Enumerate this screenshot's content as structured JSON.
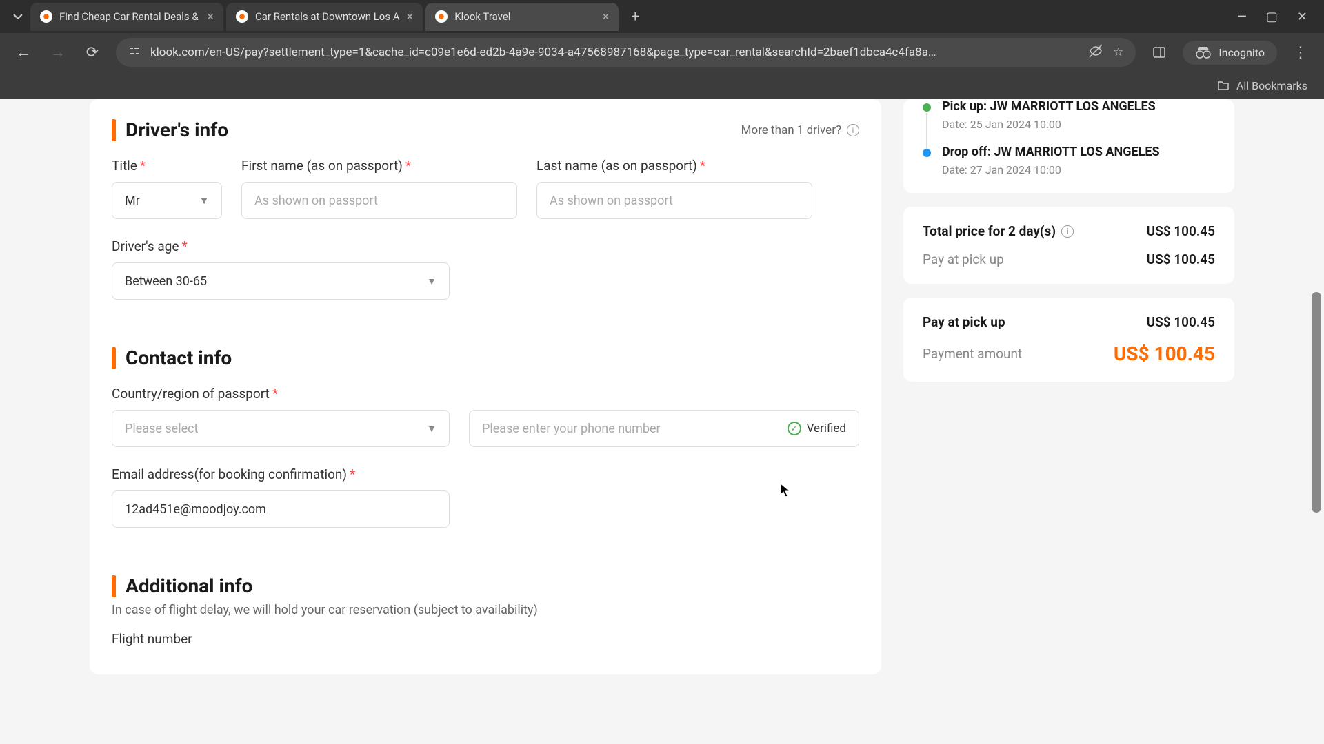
{
  "browser": {
    "tabs": [
      {
        "title": "Find Cheap Car Rental Deals &"
      },
      {
        "title": "Car Rentals at Downtown Los A"
      },
      {
        "title": "Klook Travel"
      }
    ],
    "url": "klook.com/en-US/pay?settlement_type=1&cache_id=c09e1e6d-ed2b-4a9e-9034-a47568987168&page_type=car_rental&searchId=2baef1dbca4c4fa8a…",
    "incognito_label": "Incognito",
    "bookmarks_label": "All Bookmarks"
  },
  "driver_section": {
    "title": "Driver's info",
    "more_drivers": "More than 1 driver?",
    "title_label": "Title",
    "title_value": "Mr",
    "first_name_label": "First name (as on passport)",
    "first_name_placeholder": "As shown on passport",
    "last_name_label": "Last name (as on passport)",
    "last_name_placeholder": "As shown on passport",
    "age_label": "Driver's age",
    "age_value": "Between 30-65"
  },
  "contact_section": {
    "title": "Contact info",
    "country_label": "Country/region of passport",
    "country_placeholder": "Please select",
    "phone_placeholder": "Please enter your phone number",
    "verified_label": "Verified",
    "email_label": "Email address(for booking confirmation)",
    "email_value": "12ad451e@moodjoy.com"
  },
  "additional_section": {
    "title": "Additional info",
    "subtitle": "In case of flight delay, we will hold your car reservation (subject to availability)",
    "flight_label": "Flight number"
  },
  "sidebar": {
    "pickup": {
      "label": "Pick up: JW MARRIOTT LOS ANGELES",
      "date": "Date: 25 Jan 2024 10:00"
    },
    "dropoff": {
      "label": "Drop off: JW MARRIOTT LOS ANGELES",
      "date": "Date: 27 Jan 2024 10:00"
    },
    "total_label": "Total price for 2 day(s)",
    "total_value": "US$ 100.45",
    "pay_pickup_label": "Pay at pick up",
    "pay_pickup_value": "US$ 100.45",
    "pay_pickup_bold_label": "Pay at pick up",
    "pay_pickup_bold_value": "US$ 100.45",
    "payment_label": "Payment amount",
    "payment_value": "US$ 100.45"
  }
}
